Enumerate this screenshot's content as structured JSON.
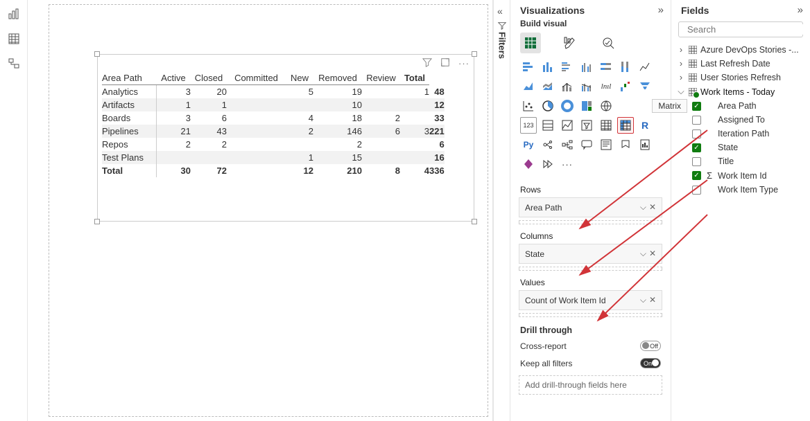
{
  "panels": {
    "visualizations": {
      "title": "Visualizations",
      "subhead": "Build visual",
      "tooltip": "Matrix"
    },
    "fields": {
      "title": "Fields"
    },
    "filters": {
      "label": "Filters"
    }
  },
  "search": {
    "placeholder": "Search"
  },
  "wells": {
    "rows_label": "Rows",
    "rows_value": "Area Path",
    "cols_label": "Columns",
    "cols_value": "State",
    "values_label": "Values",
    "values_value": "Count of Work Item Id"
  },
  "drill": {
    "title": "Drill through",
    "cross_report": "Cross-report",
    "keep_filters": "Keep all filters",
    "off": "Off",
    "on": "On",
    "placeholder": "Add drill-through fields here"
  },
  "fields_tree": {
    "t1": "Azure DevOps Stories -...",
    "t2": "Last Refresh Date",
    "t3": "User Stories Refresh",
    "t4": "Work Items - Today",
    "children": {
      "area_path": "Area Path",
      "assigned_to": "Assigned To",
      "iteration_path": "Iteration Path",
      "state": "State",
      "title": "Title",
      "work_item_id": "Work Item Id",
      "work_item_type": "Work Item Type"
    }
  },
  "chart_data": {
    "type": "table",
    "corner": "Area Path",
    "columns": [
      "Active",
      "Closed",
      "Committed",
      "New",
      "Removed",
      "Review",
      "Total"
    ],
    "rows": [
      {
        "label": "Analytics",
        "values": [
          "3",
          "20",
          "",
          "5",
          "19",
          "",
          "1",
          "48"
        ]
      },
      {
        "label": "Artifacts",
        "values": [
          "1",
          "1",
          "",
          "",
          "10",
          "",
          "",
          "12"
        ]
      },
      {
        "label": "Boards",
        "values": [
          "3",
          "6",
          "",
          "4",
          "18",
          "2",
          "",
          "33"
        ]
      },
      {
        "label": "Pipelines",
        "values": [
          "21",
          "43",
          "",
          "2",
          "146",
          "6",
          "3",
          "221"
        ]
      },
      {
        "label": "Repos",
        "values": [
          "2",
          "2",
          "",
          "",
          "2",
          "",
          "",
          "6"
        ]
      },
      {
        "label": "Test Plans",
        "values": [
          "",
          "",
          "",
          "1",
          "15",
          "",
          "",
          "16"
        ]
      }
    ],
    "totals": {
      "label": "Total",
      "values": [
        "30",
        "72",
        "",
        "12",
        "210",
        "8",
        "4",
        "336"
      ]
    }
  }
}
